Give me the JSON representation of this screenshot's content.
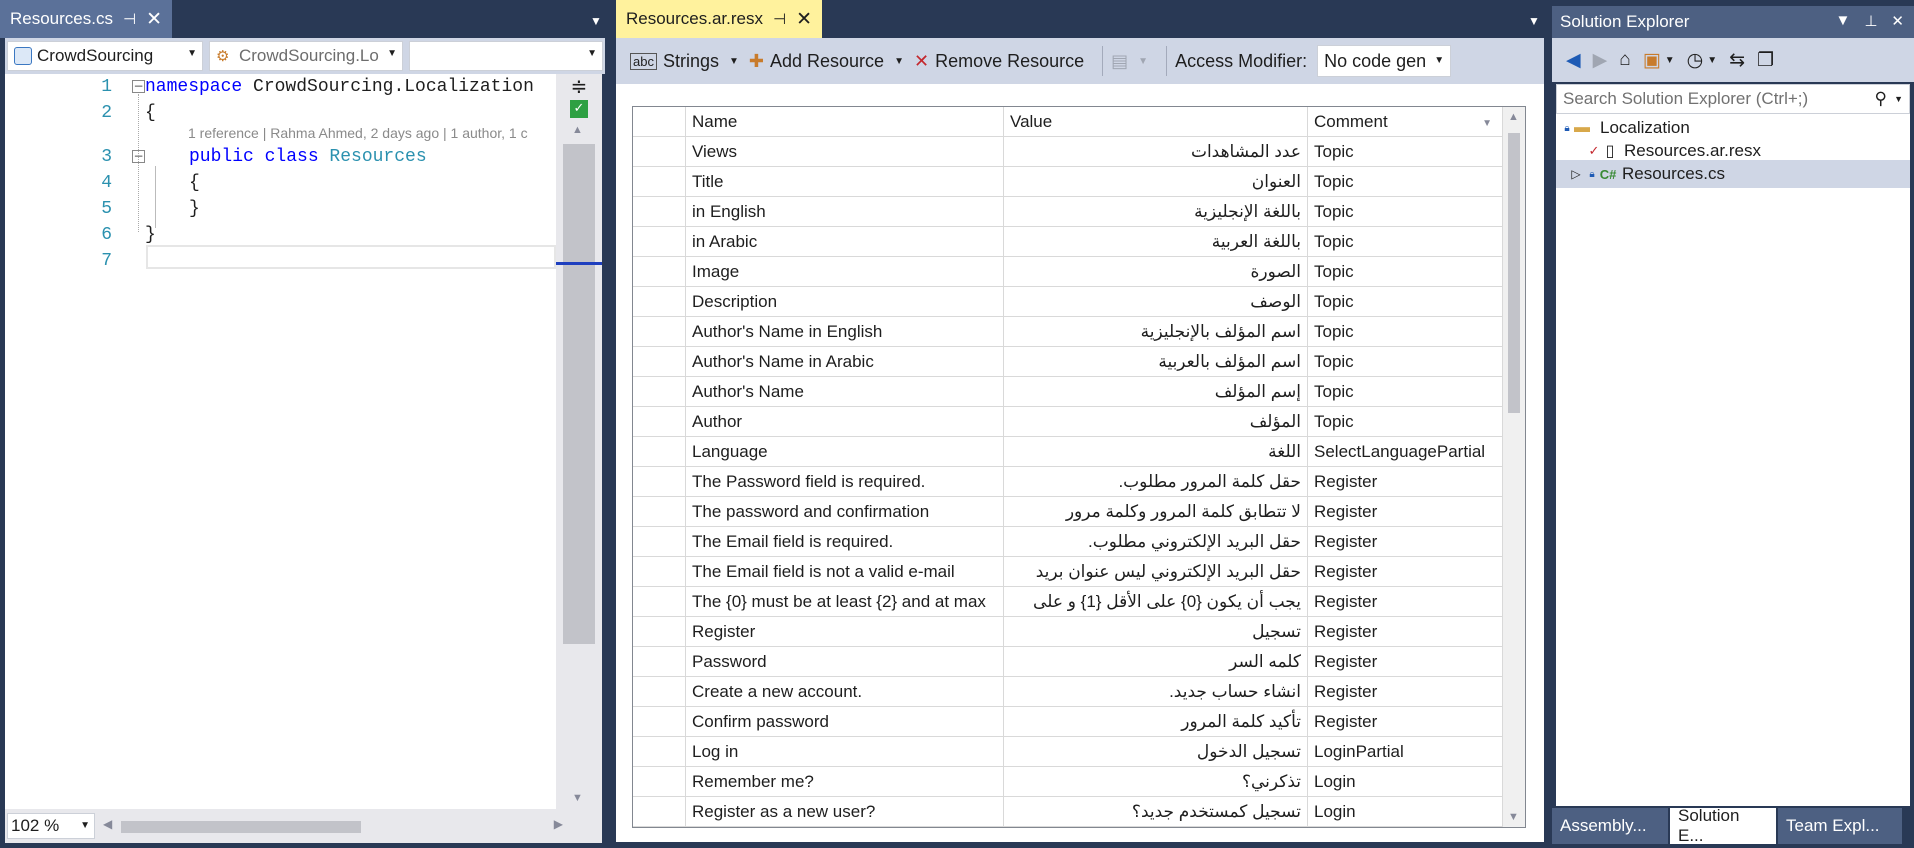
{
  "left_editor": {
    "tab": {
      "title": "Resources.cs",
      "pin_icon": "pin-icon",
      "close_icon": "close-icon"
    },
    "nav": {
      "project": "CrowdSourcing",
      "scope": "CrowdSourcing.Lo",
      "member": ""
    },
    "code_lines": [
      {
        "num": "1",
        "text": "namespace CrowdSourcing.Localization"
      },
      {
        "num": "2",
        "text": "{"
      },
      {
        "num": "3",
        "text": "public class Resources"
      },
      {
        "num": "4",
        "text": "{"
      },
      {
        "num": "5",
        "text": "}"
      },
      {
        "num": "6",
        "text": "}"
      },
      {
        "num": "7",
        "text": ""
      }
    ],
    "code_tokens": {
      "namespace_kw": "namespace",
      "namespace_name": " CrowdSourcing.Localization",
      "public_kw": "public",
      "class_kw": " class",
      "class_name": " Resources"
    },
    "codelens": "1 reference | Rahma Ahmed, 2 days ago | 1 author, 1 c",
    "zoom": "102 %"
  },
  "resx_editor": {
    "tab": {
      "title": "Resources.ar.resx",
      "pin_icon": "pin-icon",
      "close_icon": "close-icon"
    },
    "toolbar": {
      "strings_label": "Strings",
      "add_resource_label": "Add Resource",
      "remove_resource_label": "Remove Resource",
      "access_modifier_label": "Access Modifier:",
      "access_modifier_value": "No code gen"
    },
    "columns": [
      "Name",
      "Value",
      "Comment"
    ],
    "rows": [
      {
        "name": "Views",
        "value": "عدد المشاهدات",
        "comment": "Topic"
      },
      {
        "name": "Title",
        "value": "العنوان",
        "comment": "Topic"
      },
      {
        "name": "in English",
        "value": "باللغة الإنجليزية",
        "comment": "Topic"
      },
      {
        "name": "in Arabic",
        "value": "باللغة العربية",
        "comment": "Topic"
      },
      {
        "name": "Image",
        "value": "الصورة",
        "comment": "Topic"
      },
      {
        "name": "Description",
        "value": "الوصف",
        "comment": "Topic"
      },
      {
        "name": "Author's Name in English",
        "value": "اسم المؤلف بالإنجليزية",
        "comment": "Topic"
      },
      {
        "name": "Author's Name in Arabic",
        "value": "اسم المؤلف بالعربية",
        "comment": "Topic"
      },
      {
        "name": "Author's Name",
        "value": "إسم المؤلف",
        "comment": "Topic"
      },
      {
        "name": "Author",
        "value": "المؤلف",
        "comment": "Topic"
      },
      {
        "name": "Language",
        "value": "اللغة",
        "comment": "SelectLanguagePartial"
      },
      {
        "name": "The Password field is required.",
        "value": "حقل كلمة المرور مطلوب.",
        "comment": "Register"
      },
      {
        "name": "The password and confirmation",
        "value": "لا تتطابق كلمة المرور وكلمة مرور",
        "comment": "Register"
      },
      {
        "name": "The Email field is required.",
        "value": "حقل البريد الإلكتروني مطلوب.",
        "comment": "Register"
      },
      {
        "name": "The Email field is not a valid e-mail",
        "value": "حقل البريد الإلكتروني ليس عنوان بريد",
        "comment": "Register"
      },
      {
        "name": "The {0} must be at least {2} and at max",
        "value": "يجب أن يكون {0} على الأقل {1} و على",
        "comment": "Register"
      },
      {
        "name": "Register",
        "value": "تسجيل",
        "comment": "Register"
      },
      {
        "name": "Password",
        "value": "كلمه السر",
        "comment": "Register"
      },
      {
        "name": "Create a new account.",
        "value": "انشاء حساب جديد.",
        "comment": "Register"
      },
      {
        "name": "Confirm password",
        "value": "تأكيد كلمة المرور",
        "comment": "Register"
      },
      {
        "name": "Log in",
        "value": "تسجيل الدخول",
        "comment": "LoginPartial"
      },
      {
        "name": "Remember me?",
        "value": "تذكرني؟",
        "comment": "Login"
      },
      {
        "name": "Register as a new user?",
        "value": "تسجيل كمستخدم جديد؟",
        "comment": "Login"
      }
    ]
  },
  "solution_explorer": {
    "title": "Solution Explorer",
    "search_placeholder": "Search Solution Explorer (Ctrl+;)",
    "tree": [
      {
        "label": "Localization",
        "icon": "folder-icon"
      },
      {
        "label": "Resources.ar.resx",
        "icon": "file-icon"
      },
      {
        "label": "Resources.cs",
        "icon": "csharp-file-icon"
      }
    ],
    "bottom_tabs": [
      "Assembly...",
      "Solution E...",
      "Team Expl..."
    ]
  }
}
